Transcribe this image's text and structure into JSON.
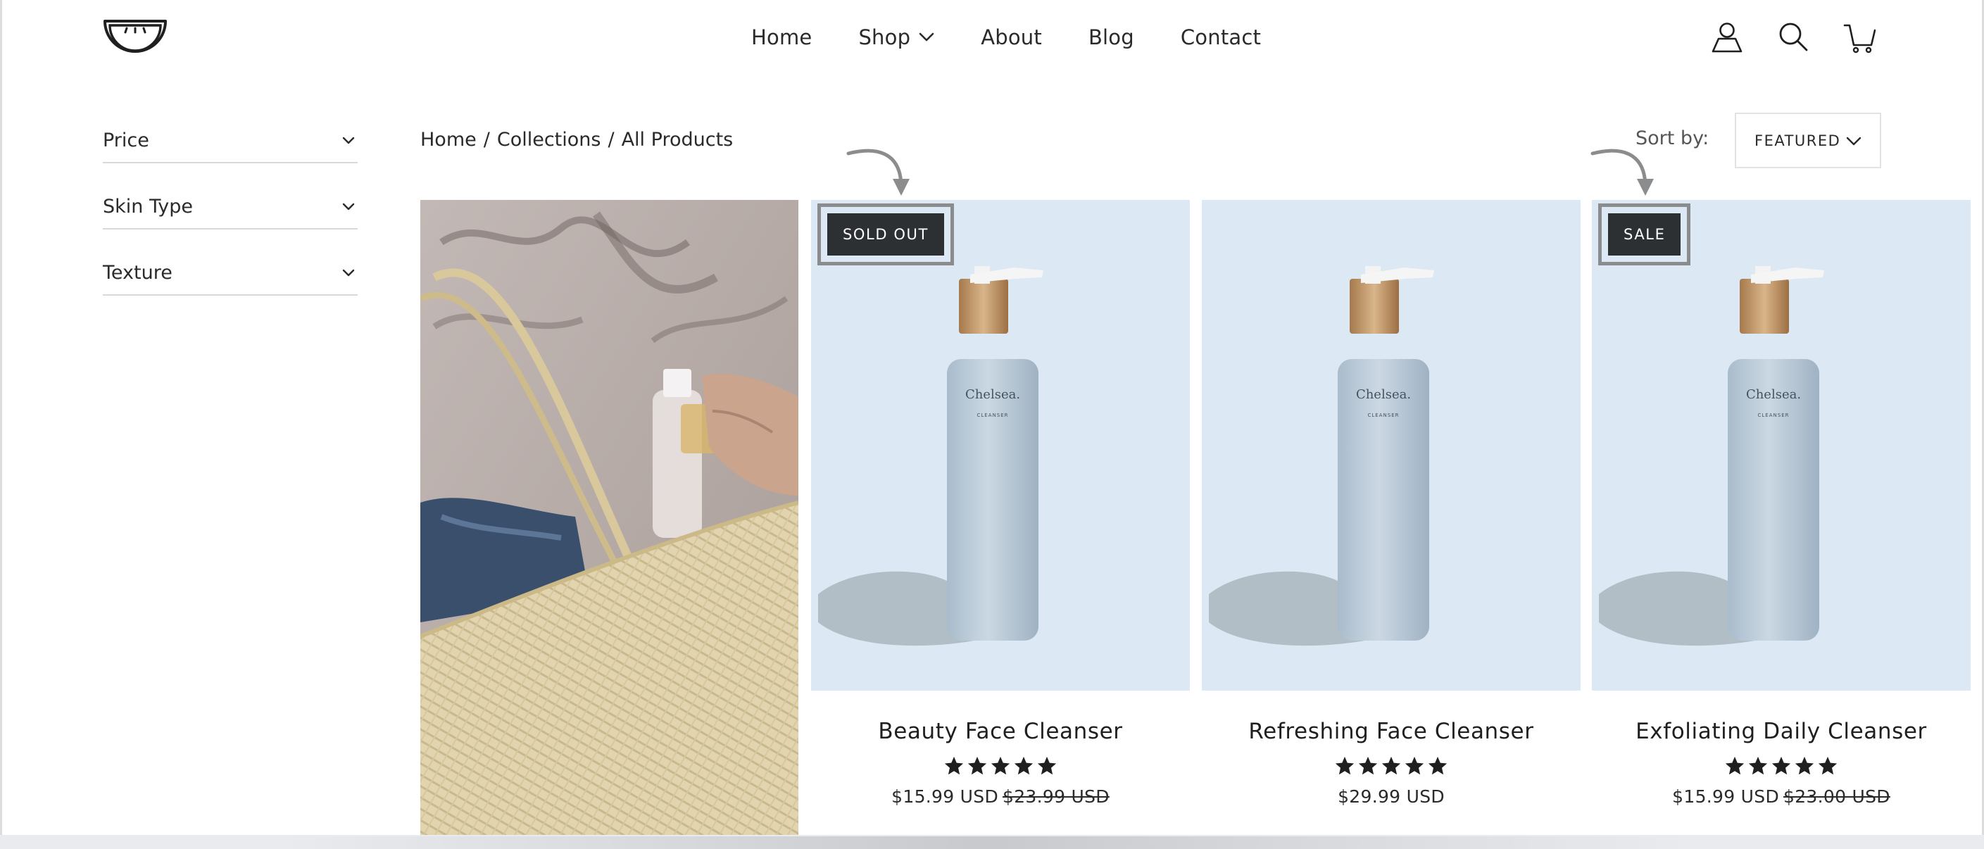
{
  "header": {
    "nav": [
      {
        "label": "Home"
      },
      {
        "label": "Shop"
      },
      {
        "label": "About"
      },
      {
        "label": "Blog"
      },
      {
        "label": "Contact"
      }
    ],
    "icons": [
      "account-icon",
      "search-icon",
      "cart-icon"
    ]
  },
  "filters": [
    {
      "label": "Price"
    },
    {
      "label": "Skin Type"
    },
    {
      "label": "Texture"
    }
  ],
  "breadcrumb": {
    "items": [
      "Home",
      "Collections",
      "All Products"
    ],
    "separator": "/"
  },
  "sort": {
    "label": "Sort by:",
    "value": "FEATURED"
  },
  "products": [
    {
      "title": "Beauty Face Cleanser",
      "badge": "SOLD OUT",
      "rating": 5,
      "price": "$15.99 USD",
      "compare_price": "$23.99 USD",
      "bottle_brand": "Chelsea.",
      "bottle_type": "CLEANSER"
    },
    {
      "title": "Refreshing Face Cleanser",
      "badge": "",
      "rating": 5,
      "price": "$29.99 USD",
      "compare_price": "",
      "bottle_brand": "Chelsea.",
      "bottle_type": "CLEANSER"
    },
    {
      "title": "Exfoliating Daily Cleanser",
      "badge": "SALE",
      "rating": 5,
      "price": "$15.99 USD",
      "compare_price": "$23.00 USD",
      "bottle_brand": "Chelsea.",
      "bottle_type": "CLEANSER"
    }
  ],
  "colors": {
    "product_bg": "#dce8f4",
    "badge_bg": "#2d3033",
    "annotation": "#8a8c8e",
    "text": "#1f1f1f"
  }
}
